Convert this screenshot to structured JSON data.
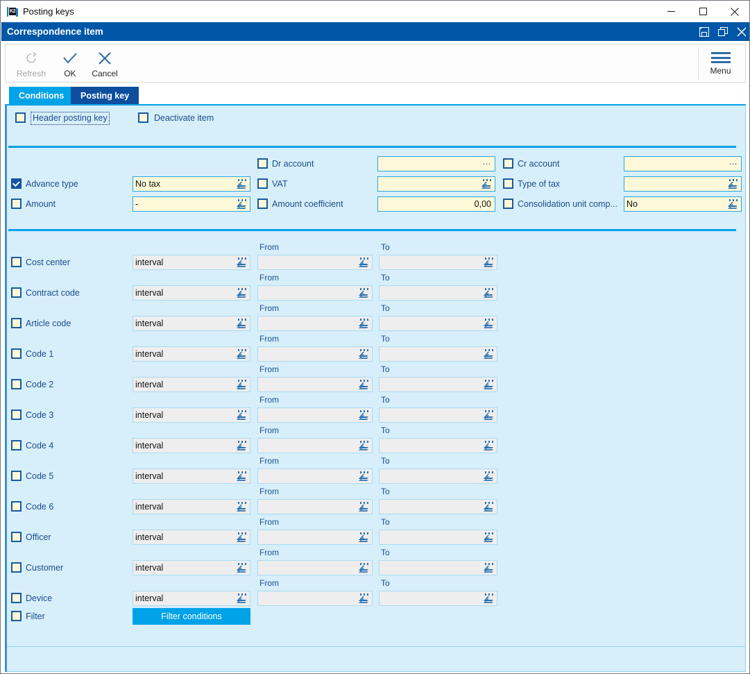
{
  "window": {
    "title": "Posting keys",
    "app_icon": "k2-logo-icon",
    "controls": {
      "minimize": "minimize-icon",
      "maximize": "maximize-icon",
      "close": "close-icon"
    }
  },
  "app_header": {
    "title": "Correspondence item",
    "icons": [
      "save-icon",
      "restore-icon",
      "close-icon"
    ]
  },
  "toolbar": {
    "refresh_label": "Refresh",
    "ok_label": "OK",
    "cancel_label": "Cancel",
    "menu_label": "Menu"
  },
  "tabs": [
    {
      "label": "Conditions",
      "active": true
    },
    {
      "label": "Posting key",
      "active": false
    }
  ],
  "top_options": [
    {
      "label": "Header posting key",
      "checked": false,
      "focused": true
    },
    {
      "label": "Deactivate item",
      "checked": false,
      "focused": false
    }
  ],
  "detail_section": {
    "left_column": [
      {
        "label": "Advance type",
        "checked": true,
        "value": "No tax",
        "control": "dropdown"
      },
      {
        "label": "Amount",
        "checked": false,
        "value": "-",
        "control": "dropdown"
      }
    ],
    "middle_column": [
      {
        "label": "Dr account",
        "checked": false,
        "value": "",
        "control": "ellipsis"
      },
      {
        "label": "VAT",
        "checked": false,
        "value": "",
        "control": "dropdown"
      },
      {
        "label": "Amount coefficient",
        "checked": false,
        "value": "0,00",
        "control": "none",
        "align": "right"
      }
    ],
    "right_column": [
      {
        "label": "Cr account",
        "checked": false,
        "value": "",
        "control": "ellipsis"
      },
      {
        "label": "Type of tax",
        "checked": false,
        "value": "",
        "control": "dropdown"
      },
      {
        "label": "Consolidation unit comp...",
        "checked": false,
        "value": "No",
        "control": "dropdown"
      }
    ]
  },
  "interval_section": {
    "from_label": "From",
    "to_label": "To",
    "mode_value": "interval",
    "rows": [
      {
        "label": "Cost center",
        "checked": false,
        "mode": "interval",
        "from": "",
        "to": ""
      },
      {
        "label": "Contract code",
        "checked": false,
        "mode": "interval",
        "from": "",
        "to": ""
      },
      {
        "label": "Article code",
        "checked": false,
        "mode": "interval",
        "from": "",
        "to": ""
      },
      {
        "label": "Code 1",
        "checked": false,
        "mode": "interval",
        "from": "",
        "to": ""
      },
      {
        "label": "Code 2",
        "checked": false,
        "mode": "interval",
        "from": "",
        "to": ""
      },
      {
        "label": "Code 3",
        "checked": false,
        "mode": "interval",
        "from": "",
        "to": ""
      },
      {
        "label": "Code 4",
        "checked": false,
        "mode": "interval",
        "from": "",
        "to": ""
      },
      {
        "label": "Code 5",
        "checked": false,
        "mode": "interval",
        "from": "",
        "to": ""
      },
      {
        "label": "Code 6",
        "checked": false,
        "mode": "interval",
        "from": "",
        "to": ""
      },
      {
        "label": "Officer",
        "checked": false,
        "mode": "interval",
        "from": "",
        "to": ""
      },
      {
        "label": "Customer",
        "checked": false,
        "mode": "interval",
        "from": "",
        "to": ""
      },
      {
        "label": "Device",
        "checked": false,
        "mode": "interval",
        "from": "",
        "to": ""
      }
    ],
    "filter_row": {
      "label": "Filter",
      "checked": false,
      "button_label": "Filter conditions"
    }
  },
  "colors": {
    "header_blue": "#0057a8",
    "tab_active": "#00a2e8",
    "tab_inactive": "#0d4f9e",
    "panel_bg": "#d7eefb",
    "field_yellow": "#fdf8d8",
    "field_grey": "#eeeeee",
    "label_blue": "#1b4f8a",
    "checkbox_checked": "#14539e",
    "accent_cyan": "#00a2e8"
  }
}
